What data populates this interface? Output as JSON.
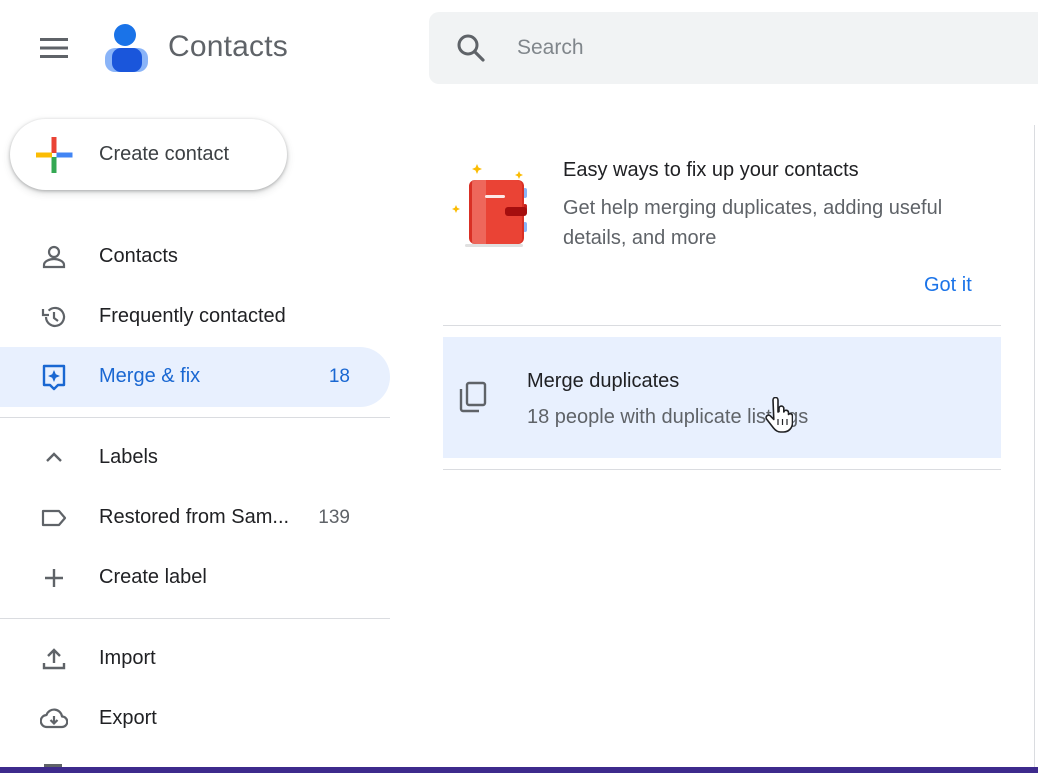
{
  "app": {
    "title": "Contacts"
  },
  "search": {
    "placeholder": "Search"
  },
  "create_button": {
    "label": "Create contact"
  },
  "nav": {
    "contacts": {
      "label": "Contacts"
    },
    "frequent": {
      "label": "Frequently contacted"
    },
    "merge": {
      "label": "Merge & fix",
      "count": "18"
    }
  },
  "labels_section": {
    "header": "Labels",
    "items": [
      {
        "label": "Restored from Sam...",
        "count": "139"
      }
    ],
    "create": "Create label"
  },
  "actions": {
    "import": "Import",
    "export": "Export"
  },
  "promo": {
    "title": "Easy ways to fix up your contacts",
    "description": "Get help merging duplicates, adding useful details, and more",
    "dismiss": "Got it"
  },
  "merge_card": {
    "title": "Merge duplicates",
    "subtitle": "18 people with duplicate listings"
  },
  "icons": [
    "menu-icon",
    "contacts-logo-icon",
    "search-icon",
    "plus-icon",
    "person-icon",
    "history-icon",
    "merge-fix-icon",
    "chevron-up-icon",
    "label-icon",
    "add-icon",
    "upload-icon",
    "cloud-download-icon",
    "copy-icon",
    "address-book-illustration",
    "hand-pointer-icon"
  ],
  "colors": {
    "accent": "#1a73e8",
    "active_bg": "#e8f0fe",
    "search_bg": "#f1f3f4",
    "text": "#202124",
    "muted": "#5f6368"
  }
}
